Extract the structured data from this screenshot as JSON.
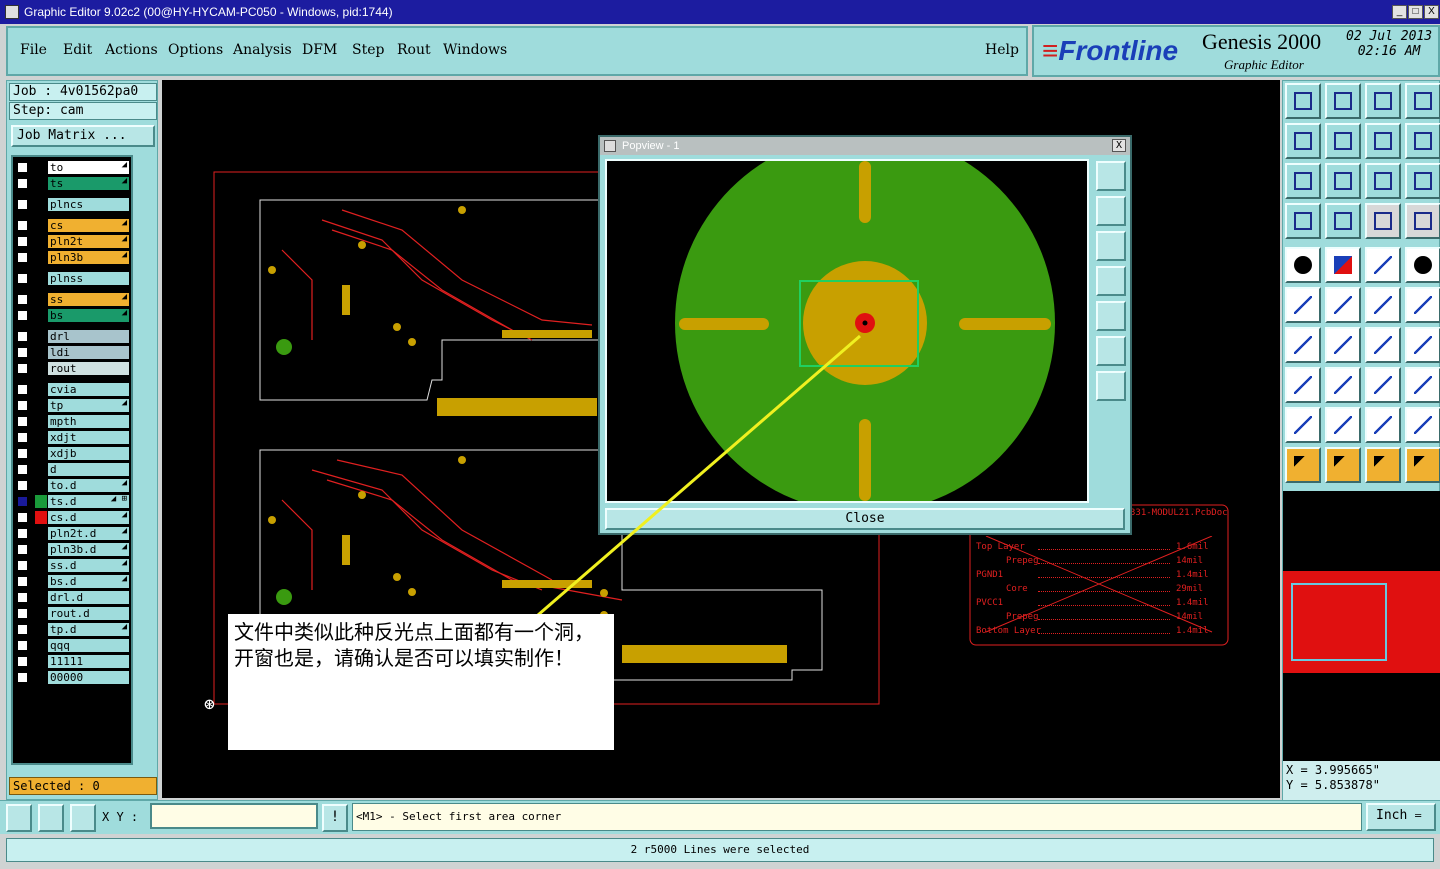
{
  "window": {
    "title": "Graphic Editor 9.02c2 (00@HY-HYCAM-PC050 - Windows, pid:1744)",
    "btn_min": "_",
    "btn_max": "□",
    "btn_close": "X"
  },
  "menu": {
    "file": "File",
    "edit": "Edit",
    "actions": "Actions",
    "options": "Options",
    "analysis": "Analysis",
    "dfm": "DFM",
    "step": "Step",
    "rout": "Rout",
    "windows": "Windows",
    "help": "Help"
  },
  "brand": {
    "logo_main": "Frontline",
    "product": "Genesis 2000",
    "subtitle": "Graphic Editor",
    "date": "02 Jul 2013",
    "time": "02:16 AM"
  },
  "job": {
    "job_label": "Job : 4v01562pa0",
    "step_label": "Step: cam",
    "matrix_button": "Job Matrix ...",
    "selected": "Selected : 0"
  },
  "layers": [
    {
      "name": "to",
      "color": "#ffffff",
      "mark": "◢",
      "checked": false
    },
    {
      "name": "ts",
      "color": "#1a9a6a",
      "mark": "◢",
      "checked": false
    },
    {
      "name": "plncs",
      "color": "#9fdcdc",
      "mark": "",
      "checked": false
    },
    {
      "name": "cs",
      "color": "#f0b030",
      "mark": "◢",
      "checked": false
    },
    {
      "name": "pln2t",
      "color": "#f0b030",
      "mark": "◢",
      "checked": false
    },
    {
      "name": "pln3b",
      "color": "#f0b030",
      "mark": "◢",
      "checked": false
    },
    {
      "name": "plnss",
      "color": "#9fdcdc",
      "mark": "",
      "checked": false
    },
    {
      "name": "ss",
      "color": "#f0b030",
      "mark": "◢",
      "checked": false
    },
    {
      "name": "bs",
      "color": "#1a9a6a",
      "mark": "◢",
      "checked": false
    },
    {
      "name": "drl",
      "color": "#a8c4cc",
      "mark": "",
      "checked": false
    },
    {
      "name": "ldi",
      "color": "#a8c4cc",
      "mark": "",
      "checked": false
    },
    {
      "name": "rout",
      "color": "#cfe0e0",
      "mark": "",
      "checked": false
    },
    {
      "name": "cvia",
      "color": "#9fdcdc",
      "mark": "",
      "checked": false
    },
    {
      "name": "tp",
      "color": "#9fdcdc",
      "mark": "◢",
      "checked": false
    },
    {
      "name": "mpth",
      "color": "#9fdcdc",
      "mark": "",
      "checked": false
    },
    {
      "name": "xdjt",
      "color": "#9fdcdc",
      "mark": "",
      "checked": false
    },
    {
      "name": "xdjb",
      "color": "#9fdcdc",
      "mark": "",
      "checked": false
    },
    {
      "name": "d",
      "color": "#9fdcdc",
      "mark": "",
      "checked": false
    },
    {
      "name": "to.d",
      "color": "#9fdcdc",
      "mark": "◢",
      "checked": false
    },
    {
      "name": "ts.d",
      "color": "#9fdcdc",
      "mark": "◢ ⊞",
      "checked": true
    },
    {
      "name": "cs.d",
      "color": "#9fdcdc",
      "mark": "◢",
      "checked": false
    },
    {
      "name": "pln2t.d",
      "color": "#9fdcdc",
      "mark": "◢",
      "checked": false
    },
    {
      "name": "pln3b.d",
      "color": "#9fdcdc",
      "mark": "◢",
      "checked": false
    },
    {
      "name": "ss.d",
      "color": "#9fdcdc",
      "mark": "◢",
      "checked": false
    },
    {
      "name": "bs.d",
      "color": "#9fdcdc",
      "mark": "◢",
      "checked": false
    },
    {
      "name": "drl.d",
      "color": "#9fdcdc",
      "mark": "",
      "checked": false
    },
    {
      "name": "rout.d",
      "color": "#9fdcdc",
      "mark": "",
      "checked": false
    },
    {
      "name": "tp.d",
      "color": "#9fdcdc",
      "mark": "◢",
      "checked": false
    },
    {
      "name": "qqq",
      "color": "#9fdcdc",
      "mark": "",
      "checked": false
    },
    {
      "name": "11111",
      "color": "#9fdcdc",
      "mark": "",
      "checked": false
    },
    {
      "name": "00000",
      "color": "#9fdcdc",
      "mark": "",
      "checked": false
    }
  ],
  "layer_dot_colors": {
    "ts.d": "#1a9a3a",
    "cs.d": "#e01010"
  },
  "popview": {
    "title": "Popview - 1",
    "close_button": "Close",
    "close_x": "X"
  },
  "stackup": {
    "file": "331-MODUL21.PcbDoc",
    "rows": [
      {
        "layer": "Top Layer",
        "thick": "1.6mil"
      },
      {
        "layer": "Prepeg",
        "thick": "14mil"
      },
      {
        "layer": "PGND1",
        "thick": "1.4mil"
      },
      {
        "layer": "Core",
        "thick": "29mil"
      },
      {
        "layer": "PVCC1",
        "thick": "1.4mil"
      },
      {
        "layer": "Prepeg",
        "thick": "14mil"
      },
      {
        "layer": "Bottom Layer",
        "thick": "1.4mil"
      }
    ]
  },
  "annotation": {
    "text": "文件中类似此种反光点上面都有一个洞，开窗也是，请确认是否可以填实制作！"
  },
  "coords": {
    "x": "X = 3.995665\"",
    "y": "Y = 5.853878\""
  },
  "status": {
    "xy_label": "X Y :",
    "xy_value": "",
    "prompt": "<M1> - Select first area corner",
    "units": "Inch",
    "units_arrow": "═",
    "message": "2 r5000 Lines were selected",
    "bang": "!"
  },
  "colors": {
    "panel": "#9fdcdc",
    "green_pad": "#3a9a10",
    "copper": "#c8a000",
    "red_trace": "#e02020"
  }
}
